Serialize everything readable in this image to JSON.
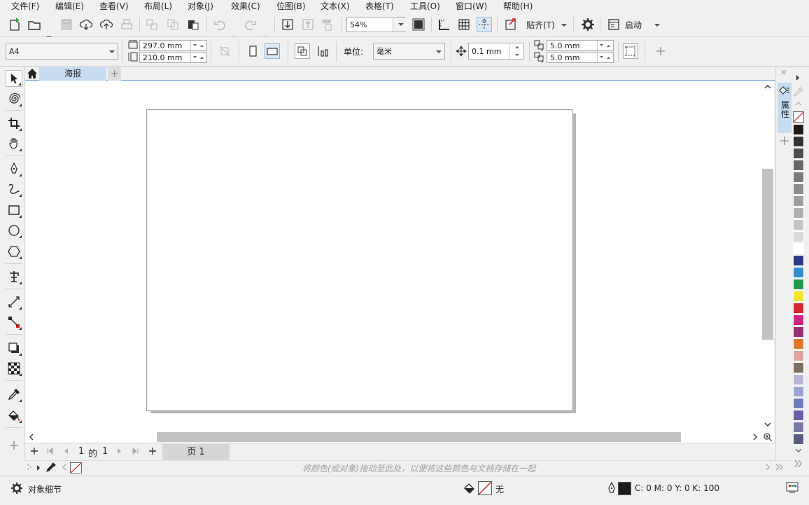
{
  "menu": [
    "文件(F)",
    "编辑(E)",
    "查看(V)",
    "布局(L)",
    "对象(J)",
    "效果(C)",
    "位图(B)",
    "文本(X)",
    "表格(T)",
    "工具(O)",
    "窗口(W)",
    "帮助(H)"
  ],
  "toolbar": {
    "zoom_value": "54%",
    "snap_label": "贴齐(T)",
    "launch_label": "启动"
  },
  "property_bar": {
    "page_size": "A4",
    "width": "297.0 mm",
    "height": "210.0 mm",
    "unit_label": "单位:",
    "unit_value": "毫米",
    "nudge": "0.1 mm",
    "dup_x": "5.0 mm",
    "dup_y": "5.0 mm"
  },
  "tabs": {
    "document": "海报",
    "add": "+"
  },
  "docker": {
    "label": "属性"
  },
  "page_nav": {
    "current": "1",
    "of": "的",
    "total": "1",
    "page_tab": "页 1"
  },
  "doc_palette_hint": "将颜色(或对象)拖动至此处，以便将这些颜色与文档存储在一起",
  "status": {
    "object_details": "对象细节",
    "fill_label": "无",
    "cmyk": "C: 0 M: 0 Y: 0 K: 100"
  },
  "palette_colors": [
    "#1f1a17",
    "#333333",
    "#4d4d4d",
    "#666666",
    "#7a7a7a",
    "#8c8c8c",
    "#9e9e9e",
    "#b0b0b0",
    "#c4c4c4",
    "#d9d9d9",
    "#ffffff",
    "#2e3a87",
    "#2f8fce",
    "#1d9a4a",
    "#f2e52a",
    "#d12a2a",
    "#d12381",
    "#9b2e74",
    "#e07a2a",
    "#e3a2a2",
    "#7d6f60",
    "#b7b5d8",
    "#9aa3d6",
    "#6f7bbd",
    "#6b5ea8",
    "#7a7aa6",
    "#585e80"
  ]
}
